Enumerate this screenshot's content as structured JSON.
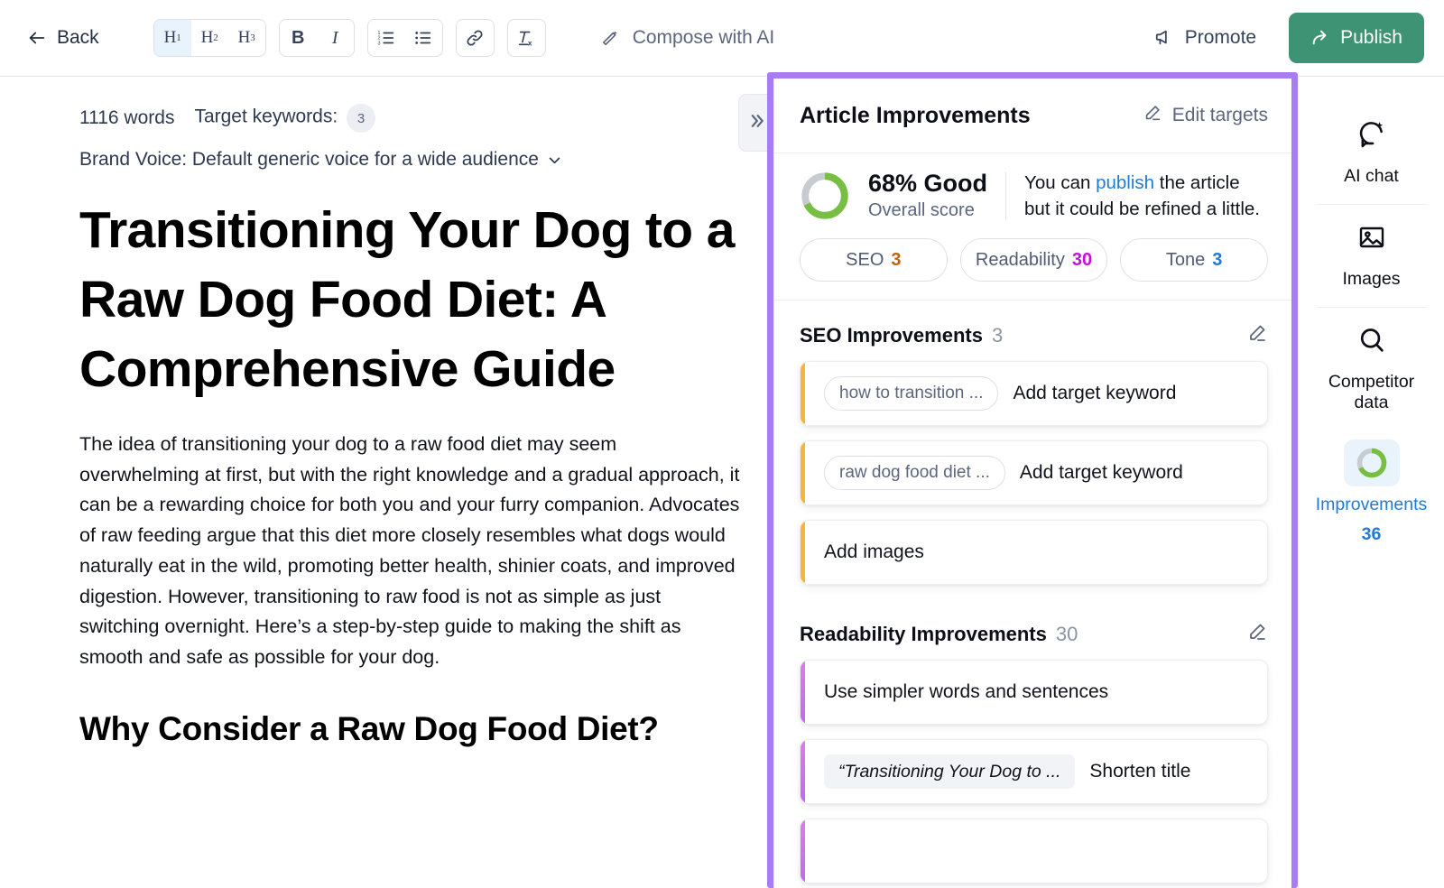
{
  "toolbar": {
    "back_label": "Back",
    "heading_buttons": [
      {
        "label": "H",
        "sub": "1",
        "active": true
      },
      {
        "label": "H",
        "sub": "2",
        "active": false
      },
      {
        "label": "H",
        "sub": "3",
        "active": false
      }
    ],
    "bold_label": "B",
    "italic_label": "I",
    "numbered_list_icon": "numbered-list-icon",
    "bullet_list_icon": "bullet-list-icon",
    "link_icon": "link-icon",
    "clear_format_icon": "clear-formatting-icon",
    "compose_label": "Compose with AI",
    "promote_label": "Promote",
    "publish_label": "Publish",
    "publish_color": "#3e9374"
  },
  "editor": {
    "word_count": "1116 words",
    "target_keywords_label": "Target keywords:",
    "target_keywords_count": "3",
    "brand_voice": "Brand Voice: Default generic voice for a wide audience",
    "title": "Transitioning Your Dog to a Raw Dog Food Diet: A Comprehensive Guide",
    "paragraph": "The idea of transitioning your dog to a raw food diet may seem overwhelming at first, but with the right knowledge and a gradual approach, it can be a rewarding choice for both you and your furry companion. Advocates of raw feeding argue that this diet more closely resembles what dogs would naturally eat in the wild, promoting better health, shinier coats, and improved digestion. However, transitioning to raw food is not as simple as just switching overnight. Here’s a step-by-step guide to making the shift as smooth and safe as possible for your dog.",
    "heading2": "Why Consider a Raw Dog Food Diet?",
    "collapse_icon": "double-chevron-right-icon"
  },
  "panel": {
    "title": "Article Improvements",
    "edit_targets_label": "Edit targets",
    "edit_targets_icon": "pencil-icon",
    "highlight_color": "#a97cf6",
    "score": {
      "percent": 68,
      "percent_label": "68% Good",
      "sub_label": "Overall score",
      "donut_color": "#76bf43",
      "donut_track": "#c7cbd2",
      "message_before": "You can ",
      "message_link": "publish",
      "message_after": " the article but it could be refined a little."
    },
    "pills": [
      {
        "label": "SEO",
        "value": "3",
        "color": "#c0620a"
      },
      {
        "label": "Readability",
        "value": "30",
        "color": "#c411d9"
      },
      {
        "label": "Tone",
        "value": "3",
        "color": "#1e7bd6"
      }
    ],
    "sections": [
      {
        "title": "SEO Improvements",
        "count": "3",
        "accent": "seo",
        "pencil_icon": "pencil-icon",
        "items": [
          {
            "tag": "how to transition ...",
            "tag_style": "pill",
            "text": "Add target keyword"
          },
          {
            "tag": "raw dog food diet ...",
            "tag_style": "pill",
            "text": "Add target keyword"
          },
          {
            "tag": "",
            "tag_style": "none",
            "text": "Add images"
          }
        ]
      },
      {
        "title": "Readability Improvements",
        "count": "30",
        "accent": "read",
        "pencil_icon": "pencil-icon",
        "items": [
          {
            "tag": "",
            "tag_style": "none",
            "text": "Use simpler words and sentences"
          },
          {
            "tag": "“Transitioning Your Dog to ...",
            "tag_style": "quote",
            "text": "Shorten title"
          }
        ]
      }
    ]
  },
  "rail": {
    "items": [
      {
        "label": "AI chat",
        "icon": "ai-chat-icon",
        "active": false,
        "count": ""
      },
      {
        "label": "Images",
        "icon": "image-icon",
        "active": false,
        "count": ""
      },
      {
        "label": "Competitor data",
        "icon": "search-icon",
        "active": false,
        "count": ""
      },
      {
        "label": "Improvements",
        "icon": "score-donut-icon",
        "active": true,
        "count": "36"
      }
    ]
  }
}
